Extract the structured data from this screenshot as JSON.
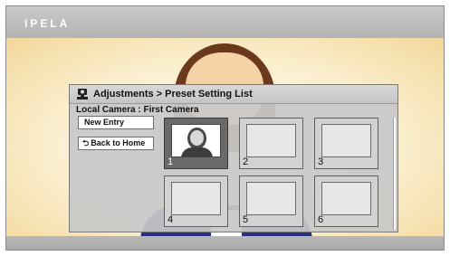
{
  "app": {
    "logo_text": "IPELA"
  },
  "dialog": {
    "title": "Adjustments > Preset Setting List",
    "camera_label": "Local Camera : First Camera",
    "buttons": {
      "new_entry": "New Entry",
      "back_to_home": "Back to Home"
    },
    "presets": [
      {
        "number": "1",
        "selected": true,
        "has_thumbnail": true
      },
      {
        "number": "2",
        "selected": false,
        "has_thumbnail": false
      },
      {
        "number": "3",
        "selected": false,
        "has_thumbnail": false
      },
      {
        "number": "4",
        "selected": false,
        "has_thumbnail": false
      },
      {
        "number": "5",
        "selected": false,
        "has_thumbnail": false
      },
      {
        "number": "6",
        "selected": false,
        "has_thumbnail": false
      }
    ]
  },
  "icons": {
    "title_icon": "camera-icon",
    "back_icon": "return-arrow-icon"
  },
  "colors": {
    "selected_slot": "#6a6a6a",
    "panel_bg": "#c8c8c8",
    "top_bar": "#bdbdbd"
  }
}
